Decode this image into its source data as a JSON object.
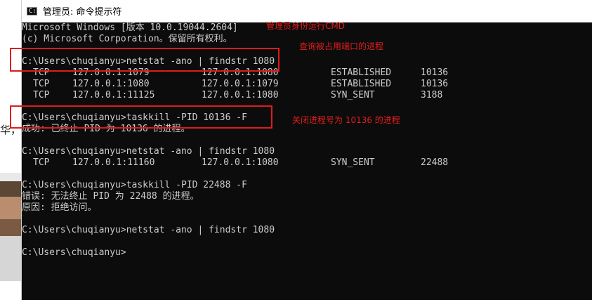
{
  "window": {
    "title": "管理员: 命令提示符",
    "icon": "terminal-icon"
  },
  "background": {
    "partial_text": "华，",
    "photo": "person-photo"
  },
  "console": {
    "header1": "Microsoft Windows [版本 10.0.19044.2604]",
    "header2": "(c) Microsoft Corporation。保留所有权利。",
    "cmd1": "C:\\Users\\chuqianyu>netstat -ano | findstr 1080",
    "table1": [
      {
        "proto": "TCP",
        "local": "127.0.0.1:1079",
        "foreign": "127.0.0.1:1080",
        "state": "ESTABLISHED",
        "pid": "10136"
      },
      {
        "proto": "TCP",
        "local": "127.0.0.1:1080",
        "foreign": "127.0.0.1:1079",
        "state": "ESTABLISHED",
        "pid": "10136"
      },
      {
        "proto": "TCP",
        "local": "127.0.0.1:11125",
        "foreign": "127.0.0.1:1080",
        "state": "SYN_SENT",
        "pid": "3188"
      }
    ],
    "cmd2": "C:\\Users\\chuqianyu>taskkill -PID 10136 -F",
    "out2": "成功: 已终止 PID 为 10136 的进程。",
    "cmd3": "C:\\Users\\chuqianyu>netstat -ano | findstr 1080",
    "table2": [
      {
        "proto": "TCP",
        "local": "127.0.0.1:11160",
        "foreign": "127.0.0.1:1080",
        "state": "SYN_SENT",
        "pid": "22488"
      }
    ],
    "cmd4": "C:\\Users\\chuqianyu>taskkill -PID 22488 -F",
    "out4a": "错误: 无法终止 PID 为 22488 的进程。",
    "out4b": "原因: 拒绝访问。",
    "cmd5": "C:\\Users\\chuqianyu>netstat -ano | findstr 1080",
    "prompt": "C:\\Users\\chuqianyu>"
  },
  "annotations": {
    "note1": "管理员身份运行CMD",
    "note2": "查询被占用端口的进程",
    "note3": "关闭进程号为 10136 的进程",
    "color": "#e01b1b"
  },
  "colors": {
    "console_bg": "#0c0c0c",
    "console_fg": "#cccccc"
  }
}
